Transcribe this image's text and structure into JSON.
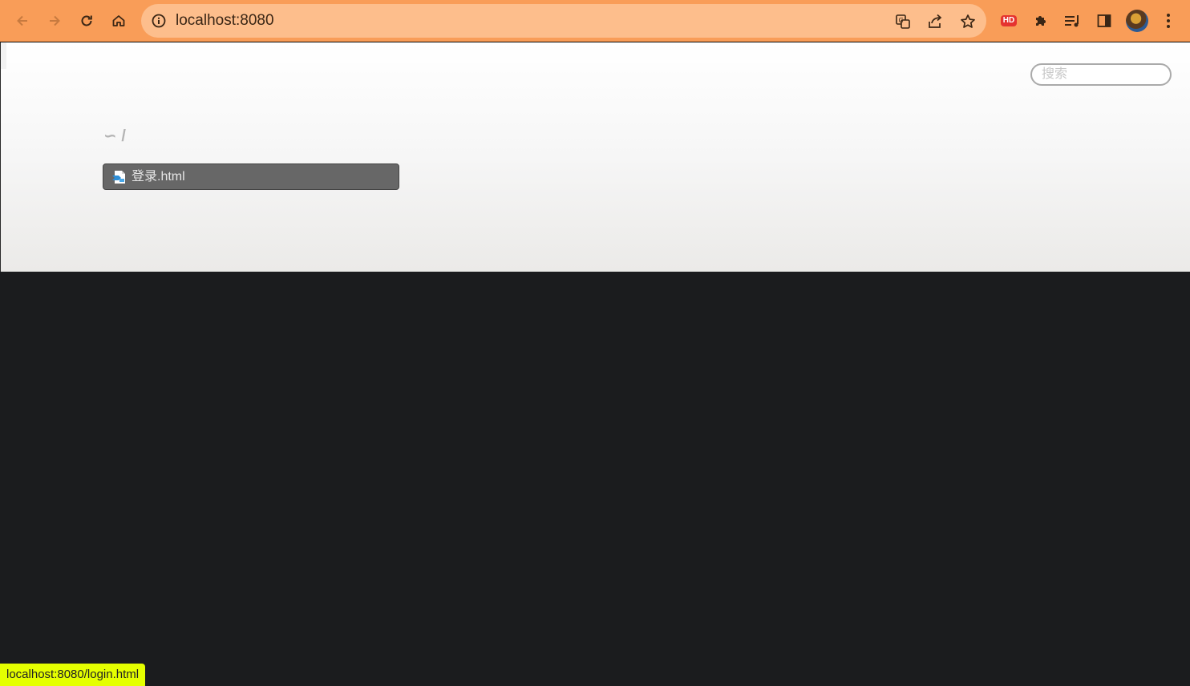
{
  "browser": {
    "url": "localhost:8080",
    "colors": {
      "toolbar": "#f99d58",
      "omnibox": "#fdbe8c"
    },
    "toolbar_icons": [
      "back-icon",
      "forward-icon",
      "reload-icon",
      "home-icon"
    ],
    "omnibox_icons": [
      "info-icon",
      "translate-icon",
      "share-icon",
      "bookmark-star-icon"
    ],
    "extensions": {
      "hd_badge": "HD"
    }
  },
  "page": {
    "search": {
      "placeholder": "搜索"
    },
    "breadcrumb": {
      "home": "∽",
      "separator": "/"
    },
    "files": [
      {
        "name": "登录.html",
        "icon": "html-file-icon"
      }
    ]
  },
  "status_bar": {
    "text": "localhost:8080/login.html"
  }
}
